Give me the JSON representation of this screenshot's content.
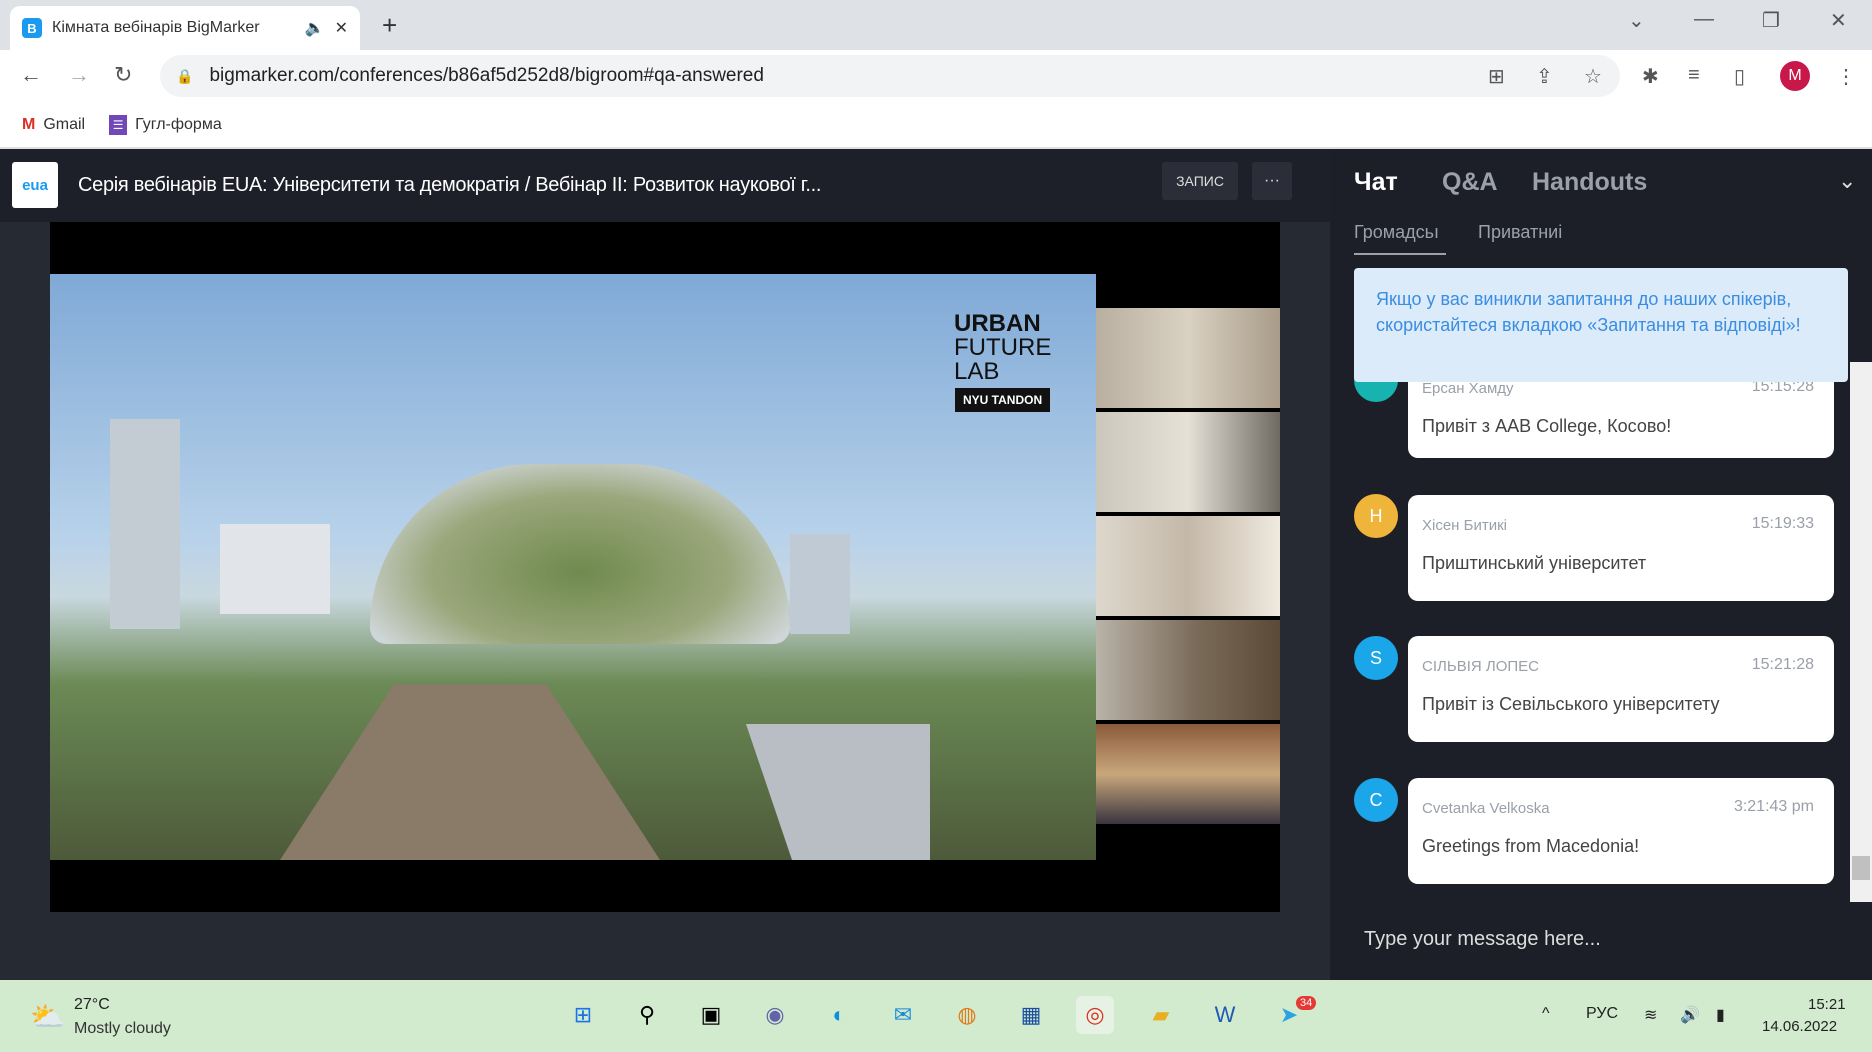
{
  "browser": {
    "tab_title": "Кімната вебінарів BigMarker",
    "url": "bigmarker.com/conferences/b86af5d252d8/bigroom#qa-answered",
    "profile_initial": "M",
    "bookmarks": [
      {
        "label": "Gmail"
      },
      {
        "label": "Гугл-форма"
      }
    ]
  },
  "webinar": {
    "logo_text": "eua",
    "title": "Серія вебінарів EUA: Університети та демократія / Вебінар II: Розвиток наукової г...",
    "record_label": "ЗАПИС",
    "more_label": "···",
    "slide": {
      "line1": "URBAN",
      "line2": "FUTURE",
      "line3": "LAB",
      "badge": "NYU TANDON"
    }
  },
  "panel": {
    "tabs": [
      "Чат",
      "Q&A",
      "Handouts"
    ],
    "subtabs": [
      "Громадсьı",
      "Приватниі"
    ],
    "banner": "Якщо у вас виникли запитання до наших спікерів, скористайтеся вкладкою «Запитання та відповіді»!",
    "messages": [
      {
        "initial": "",
        "name": "Ерсан Хамду",
        "time": "15:15:28",
        "text": "Привіт з AAB College, Косово!",
        "color": "#17b3b0"
      },
      {
        "initial": "H",
        "name": "Хісен Битикі",
        "time": "15:19:33",
        "text": "Приштинський університет",
        "color": "#efb43a"
      },
      {
        "initial": "S",
        "name": "СІЛЬВІЯ ЛОПЕС",
        "time": "15:21:28",
        "text": "Привіт із Севільського університету",
        "color": "#1aa6e8"
      },
      {
        "initial": "C",
        "name": "Cvetanka Velkoska",
        "time": "3:21:43 pm",
        "text": "Greetings from Macedonia!",
        "color": "#1aa6e8"
      }
    ],
    "input_placeholder": "Type your message here..."
  },
  "taskbar": {
    "temp": "27°C",
    "weather": "Mostly cloudy",
    "lang": "РУС",
    "time": "15:21",
    "date": "14.06.2022",
    "telegram_badge": "34"
  }
}
